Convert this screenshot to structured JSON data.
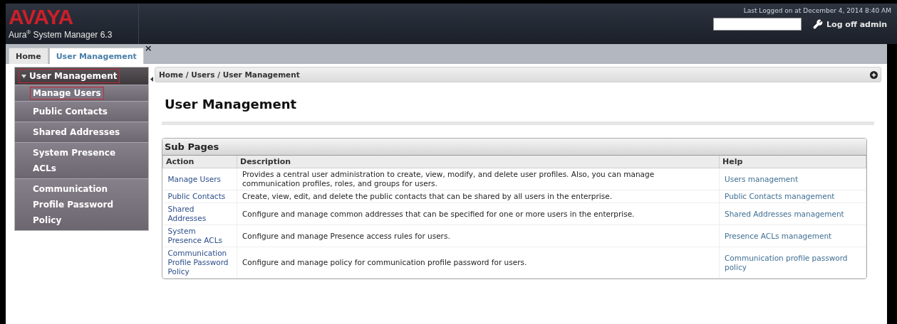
{
  "header": {
    "logo": "AVAYA",
    "product": "Aura$^{®}$ System Manager 6.3",
    "last_logged": "Last Logged on at December 4, 2014 8:40 AM",
    "logoff": "Log off admin"
  },
  "tabs": [
    {
      "label": "Home",
      "selected": false
    },
    {
      "label": "User Management",
      "selected": true,
      "close": "×"
    }
  ],
  "sidebar": {
    "title": "User Management",
    "expanded": true,
    "highlighted": true,
    "items": [
      {
        "label": "Manage Users",
        "selected": true
      },
      {
        "label": "Public Contacts",
        "selected": false
      },
      {
        "label": "Shared Addresses",
        "selected": false
      },
      {
        "label": "System Presence ACLs",
        "selected": false
      },
      {
        "label": "Communication Profile Password Policy",
        "selected": false
      }
    ]
  },
  "breadcrumb": "Home / Users / User Management",
  "page_title": "User Management",
  "table": {
    "title": "Sub Pages",
    "columns": [
      "Action",
      "Description",
      "Help"
    ],
    "rows": [
      {
        "action": "Manage Users",
        "description": "Provides a central user administration to create, view, modify, and delete user profiles. Also, you can manage communication profiles, roles, and groups for users.",
        "help": "Users management"
      },
      {
        "action": "Public Contacts",
        "description": "Create, view, edit, and delete the public contacts that can be shared by all users in the enterprise.",
        "help": "Public Contacts management"
      },
      {
        "action": "Shared Addresses",
        "description": "Configure and manage common addresses that can be specified for one or more users in the enterprise.",
        "help": "Shared Addresses management"
      },
      {
        "action": "System Presence ACLs",
        "description": "Configure and manage Presence access rules for users.",
        "help": "Presence ACLs management"
      },
      {
        "action": "Communication Profile Password Policy",
        "description": "Configure and manage policy for communication profile password for users.",
        "help": "Communication profile password policy"
      }
    ]
  }
}
